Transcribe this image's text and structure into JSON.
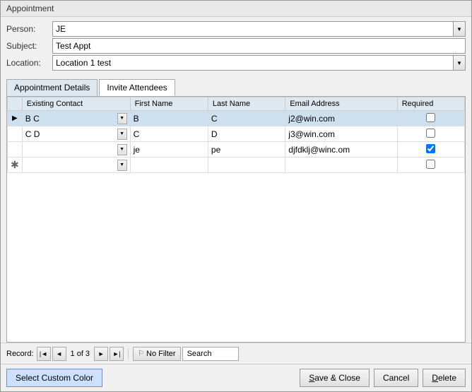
{
  "window": {
    "title": "Appointment"
  },
  "form": {
    "person_label": "Person:",
    "person_value": "JE",
    "subject_label": "Subject:",
    "subject_value": "Test Appt",
    "location_label": "Location:",
    "location_value": "Location 1 test"
  },
  "tabs": {
    "tab1_label": "Appointment Details",
    "tab2_label": "Invite Attendees",
    "active": "Invite Attendees"
  },
  "table": {
    "columns": [
      "Existing Contact",
      "First Name",
      "Last Name",
      "Email Address",
      "Required"
    ],
    "rows": [
      {
        "indicator": "▶",
        "existing_contact": "B C",
        "first_name": "B",
        "last_name": "C",
        "email": "j2@win.com",
        "required": false,
        "checked": false
      },
      {
        "indicator": "",
        "existing_contact": "C D",
        "first_name": "C",
        "last_name": "D",
        "email": "j3@win.com",
        "required": false,
        "checked": false
      },
      {
        "indicator": "",
        "existing_contact": "",
        "first_name": "je",
        "last_name": "pe",
        "email": "djfdklj@winc.om",
        "required": true,
        "checked": true
      },
      {
        "indicator": "✱",
        "existing_contact": "",
        "first_name": "",
        "last_name": "",
        "email": "",
        "required": false,
        "checked": false,
        "is_new": true
      }
    ]
  },
  "navigation": {
    "record_text": "1 of 3",
    "no_filter_label": "No Filter",
    "search_placeholder": "Search"
  },
  "footer": {
    "custom_color_label": "Select Custom Color",
    "save_close_label": "Save & Close",
    "cancel_label": "Cancel",
    "delete_label": "Delete"
  }
}
